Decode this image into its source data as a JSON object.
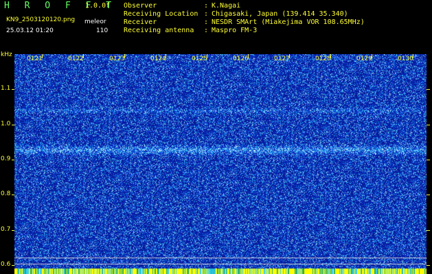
{
  "header": {
    "app_name": "H R O F F T",
    "version": "1.0.0f",
    "filename": "KN9_2503120120.png",
    "mode": "meleor",
    "datetime": "25.03.12 01:20",
    "level": "110",
    "info": [
      {
        "key": "Observer",
        "value": "K.Nagai"
      },
      {
        "key": "Receiving Location",
        "value": "Chigasaki, Japan (139.414 35.340)"
      },
      {
        "key": "Receiver",
        "value": "NESDR SMArt (Miakejima VOR 108.65MHz)"
      },
      {
        "key": "Receiving antenna",
        "value": "Maspro FM-3"
      }
    ]
  },
  "chart_data": {
    "type": "heatmap",
    "ylabel": "kHz",
    "yticks": [
      "1.1",
      "1.0",
      "0.9",
      "0.8",
      "0.7",
      "0.6"
    ],
    "ytick_values": [
      1.1,
      1.0,
      0.9,
      0.8,
      0.7,
      0.6
    ],
    "ylim": [
      0.575,
      1.2
    ],
    "xticks": [
      "0121",
      "0122",
      "0123",
      "0124",
      "0125",
      "0126",
      "0127",
      "0128",
      "0129",
      "0130"
    ],
    "bands_khz": [
      0.928,
      1.04
    ],
    "hlines_khz": [
      0.621,
      0.604
    ],
    "colors": {
      "background": "#0a1a9e",
      "band": "#4fd0ff",
      "axis": "#ffff33",
      "bottom": "#ffff00"
    }
  }
}
